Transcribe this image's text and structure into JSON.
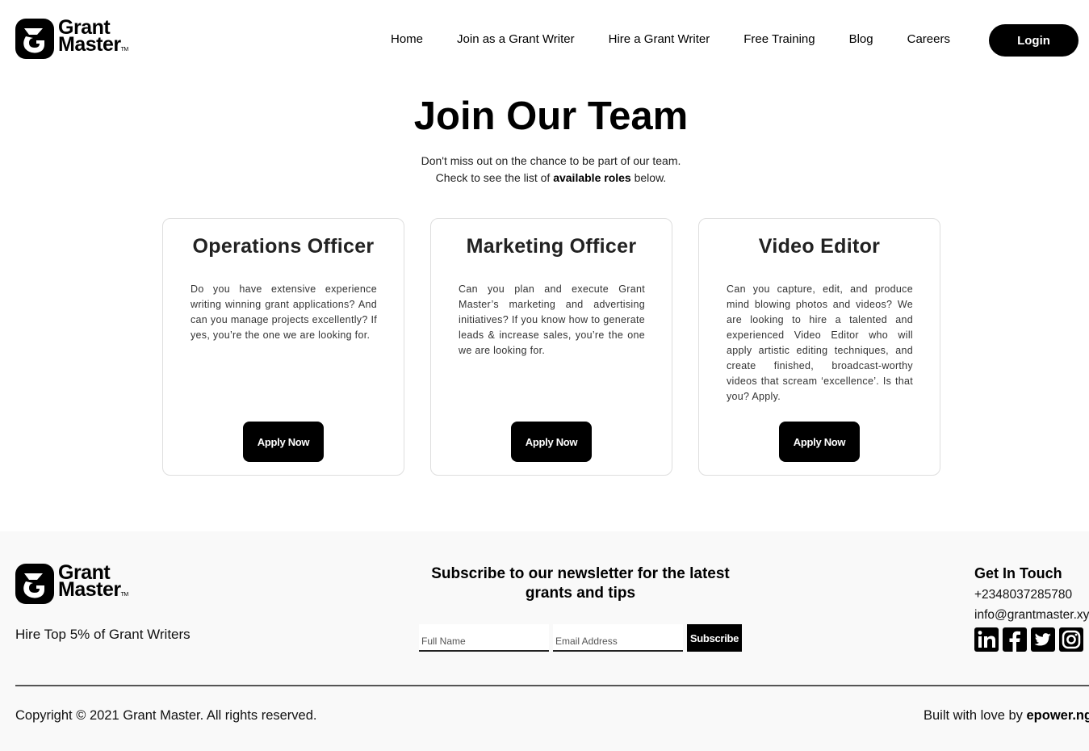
{
  "brand": {
    "line1": "Grant",
    "line2": "Master",
    "tm": "TM"
  },
  "nav": [
    {
      "label": "Home"
    },
    {
      "label": "Join as a Grant Writer"
    },
    {
      "label": "Hire a Grant Writer"
    },
    {
      "label": "Free Training"
    },
    {
      "label": "Blog"
    },
    {
      "label": "Careers"
    }
  ],
  "login_label": "Login",
  "hero": {
    "title": "Join Our Team",
    "line1": "Don't miss out on the chance to be part of our team.",
    "line2_pre": "Check to see the list of ",
    "line2_bold": "available roles",
    "line2_post": " below."
  },
  "roles": [
    {
      "title": "Operations Officer",
      "description": "Do you have extensive experience writing winning grant applications? And can you manage projects excellently? If yes, you’re the one we are looking for.",
      "apply_label": "Apply Now"
    },
    {
      "title": "Marketing Officer",
      "description": "Can you plan and execute Grant Master’s marketing and advertising initiatives? If you know how to generate leads & increase sales, you’re the one we are looking for.",
      "apply_label": "Apply Now"
    },
    {
      "title": "Video Editor",
      "description": "Can you capture, edit, and produce mind blowing photos and videos? We are looking to hire a talented and experienced Video Editor who will apply artistic editing techniques, and create finished, broadcast-worthy videos that scream ‘excellence’. Is that you? Apply.",
      "apply_label": "Apply Now"
    }
  ],
  "footer": {
    "tagline": "Hire Top 5% of Grant Writers",
    "newsletter_title": "Subscribe to our newsletter for the latest grants and tips",
    "name_placeholder": "Full Name",
    "email_placeholder": "Email Address",
    "subscribe_label": "Subscribe",
    "contact_title": "Get In Touch",
    "phone": "+2348037285780",
    "email": "info@grantmaster.xyz",
    "socials": [
      "linkedin-icon",
      "facebook-icon",
      "twitter-icon",
      "instagram-icon"
    ],
    "copyright": "Copyright © 2021 Grant Master. All rights reserved.",
    "built_pre": "Built with love by ",
    "built_link": "epower.ng"
  },
  "colors": {
    "accent": "#000000",
    "footer_bg": "#f9f9f9",
    "card_border": "#dedede"
  }
}
